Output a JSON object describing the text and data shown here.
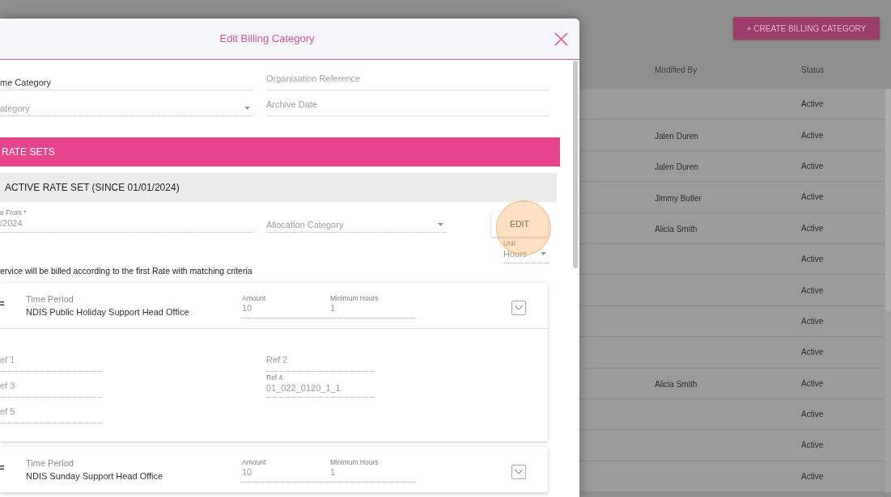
{
  "background_page": {
    "create_button": "+ CREATE BILLING CATEGORY",
    "table": {
      "columns": [
        "Modified By",
        "Status"
      ],
      "rows": [
        {
          "status": "Active"
        },
        {
          "modified_by": "Jalen Duren",
          "status": "Active"
        },
        {
          "modified_by": "Jalen Duren",
          "status": "Active"
        },
        {
          "modified_by": "Jimmy Butler",
          "status": "Active"
        },
        {
          "modified_by": "Alicia Smith",
          "status": "Active"
        },
        {
          "status": "Active"
        },
        {
          "status": "Active"
        },
        {
          "status": "Active"
        },
        {
          "status": "Active"
        },
        {
          "modified_by": "Alicia Smith",
          "status": "Active"
        },
        {
          "status": "Active"
        },
        {
          "status": "Active"
        },
        {
          "status": "Active"
        }
      ]
    }
  },
  "dialog": {
    "title": "Edit Billing Category",
    "fields": [
      {
        "kind": "text",
        "value": "me Category",
        "disabled": false
      },
      {
        "kind": "text",
        "placeholder": "Organisation Reference",
        "disabled": false
      },
      {
        "kind": "select",
        "placeholder": "ategory",
        "disabled": true
      },
      {
        "kind": "date",
        "placeholder": "Archive Date",
        "disabled": false
      }
    ],
    "section_header": "RATE SETS",
    "rate_set": {
      "title": "ACTIVE RATE SET (SINCE 01/01/2024)",
      "fields": [
        {
          "kind": "date",
          "label": "e From *",
          "value": "/2024",
          "disabled": true
        },
        {
          "kind": "select",
          "placeholder": "Allocation Category",
          "disabled": true
        }
      ],
      "edit_button": {
        "label": "EDIT",
        "highlighted": true
      },
      "unit_field": {
        "kind": "select",
        "label": "Unit",
        "value": "Hours",
        "disabled": true
      },
      "note": "ervice will be billed according to the first Rate with matching criteria",
      "rates": [
        {
          "time_period_label": "Time Period",
          "time_period": "NDIS Public Holiday Support Head Office",
          "fields": [
            {
              "label": "Amount",
              "value": "10",
              "disabled": true
            },
            {
              "label": "Minimum Hours",
              "value": "1",
              "disabled": true
            }
          ],
          "refs": [
            {
              "placeholder": "ef 1",
              "disabled": true
            },
            {
              "placeholder": "ef 3",
              "disabled": true
            },
            {
              "placeholder": "ef 5",
              "disabled": true
            },
            {
              "placeholder": "Ref 2",
              "disabled": true
            },
            {
              "label": "Ref 4",
              "value": "01_022_0120_1_1",
              "disabled": true
            }
          ]
        },
        {
          "time_period_label": "Time Period",
          "time_period": "NDIS Sunday Support Head Office",
          "fields": [
            {
              "label": "Amount",
              "value": "10",
              "disabled": true
            },
            {
              "label": "Minimum Hours",
              "value": "1",
              "disabled": true
            }
          ]
        }
      ]
    }
  }
}
